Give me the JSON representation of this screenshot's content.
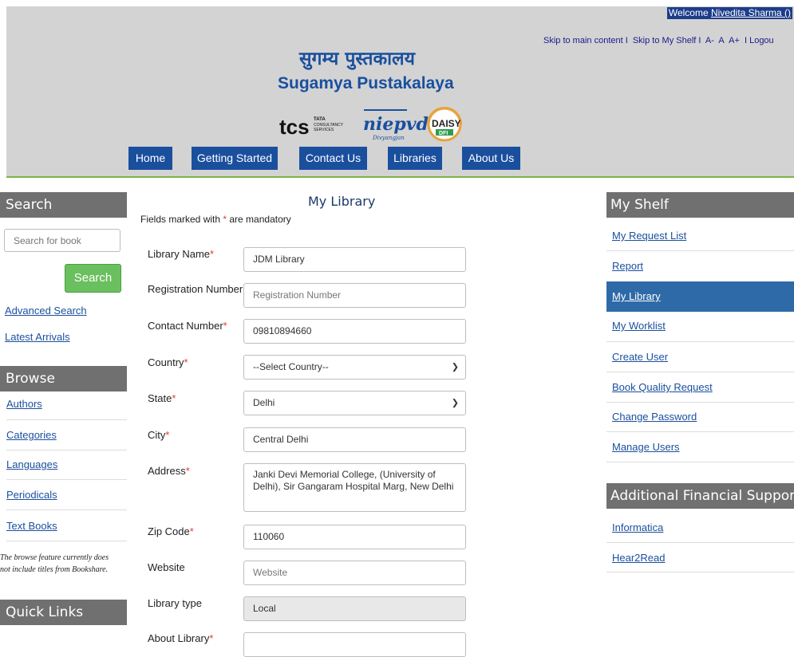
{
  "header": {
    "welcome_prefix": "Welcome ",
    "user_name": "Nivedita Sharma ()",
    "skip_main": "Skip to main content I",
    "skip_shelf": "Skip to My Shelf I",
    "font_small": "A-",
    "font_normal": "A",
    "font_large": "A+",
    "logout": "I Logou",
    "title_hindi": "सुगम्य पुस्तकालय",
    "title_english": "Sugamya Pustakalaya",
    "logo_tcs": "tcs",
    "logo_tata": "TATA",
    "logo_consultancy": "CONSULTANCY",
    "logo_services": "SERVICES",
    "logo_niepvd": "niepvd",
    "logo_divyangjan": "Divyangjan",
    "logo_daisy": "DAISY",
    "logo_dfi": "DFI"
  },
  "nav": [
    "Home",
    "Getting Started",
    "Contact Us",
    "Libraries",
    "About Us"
  ],
  "left": {
    "search_heading": "Search",
    "search_placeholder": "Search for book",
    "search_button": "Search",
    "advanced_search": "Advanced Search",
    "latest_arrivals": "Latest Arrivals",
    "browse_heading": "Browse",
    "browse_items": [
      "Authors",
      "Categories",
      "Languages",
      "Periodicals",
      "Text Books"
    ],
    "browse_note_line1": "The browse feature currently does",
    "browse_note_line2": "not include titles from Bookshare.",
    "quick_links_heading": "Quick Links"
  },
  "main": {
    "page_title": "My Library",
    "mandatory_prefix": "Fields marked with ",
    "mandatory_star": "*",
    "mandatory_suffix": " are mandatory",
    "fields": {
      "library_name": {
        "label": "Library Name",
        "value": "JDM Library"
      },
      "registration_number": {
        "label": "Registration Number",
        "placeholder": "Registration Number"
      },
      "contact_number": {
        "label": "Contact Number",
        "value": "09810894660"
      },
      "country": {
        "label": "Country",
        "value": "--Select Country--"
      },
      "state": {
        "label": "State",
        "value": "Delhi"
      },
      "city": {
        "label": "City",
        "value": "Central Delhi"
      },
      "address": {
        "label": "Address",
        "value_line1": "Janki Devi Memorial College, (University of",
        "value_line2": "Delhi), Sir Gangaram Hospital Marg, New Delhi"
      },
      "zip_code": {
        "label": "Zip Code",
        "value": "110060"
      },
      "website": {
        "label": "Website",
        "placeholder": "Website"
      },
      "library_type": {
        "label": "Library type",
        "value": "Local"
      },
      "about_library": {
        "label": "About Library"
      }
    }
  },
  "right": {
    "my_shelf_heading": "My Shelf",
    "shelf_items": [
      "My Request List",
      "Report",
      "My Library",
      "My Worklist",
      "Create User",
      "Book Quality Request",
      "Change Password",
      "Manage Users"
    ],
    "active_item": "My Library",
    "financial_heading": "Additional Financial Support",
    "financial_items": [
      "Informatica",
      "Hear2Read"
    ]
  },
  "colors": {
    "header_bg": "#d3d3d3",
    "nav_bg": "#1a4f9e",
    "section_head_bg": "#707070",
    "active_bg": "#2f6aa8",
    "search_button_bg": "#6abf5e",
    "required_star": "#e53935",
    "green_rule": "#7cb342"
  }
}
